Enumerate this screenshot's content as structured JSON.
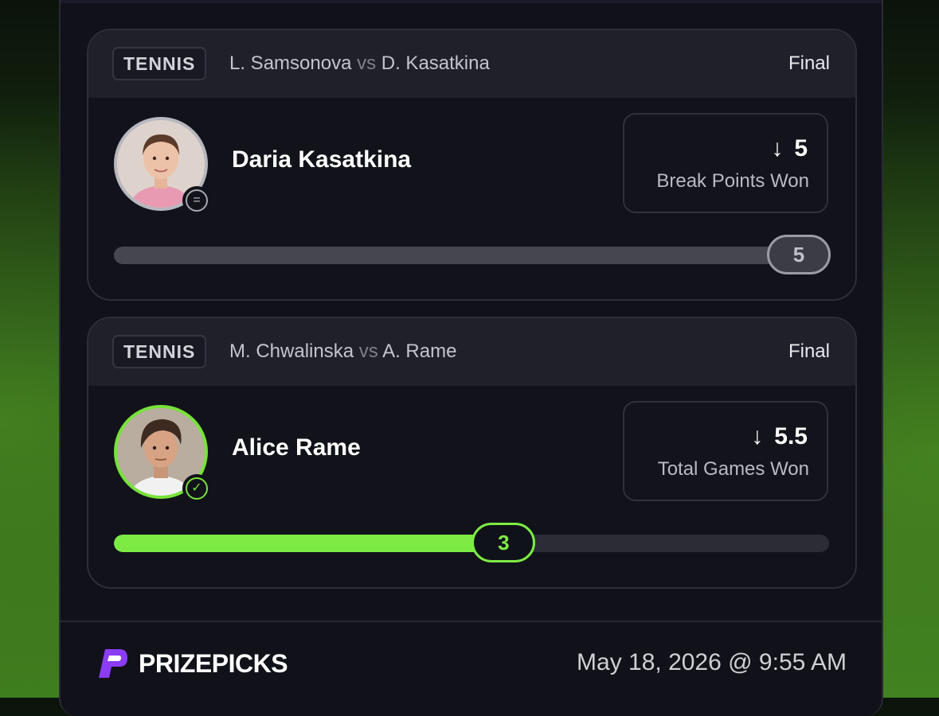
{
  "cards": [
    {
      "sport": "TENNIS",
      "player1": "L. Samsonova",
      "vs": "vs",
      "player2": "D. Kasatkina",
      "status": "Final",
      "player_name": "Daria Kasatkina",
      "direction_icon": "arrow-down-icon",
      "line": "5",
      "stat_type": "Break Points Won",
      "result_badge_icon": "equals-icon",
      "progress_value": "5",
      "progress_fraction": 1.0,
      "progress_color": "#45464f"
    },
    {
      "sport": "TENNIS",
      "player1": "M. Chwalinska",
      "vs": "vs",
      "player2": "A. Rame",
      "status": "Final",
      "player_name": "Alice Rame",
      "direction_icon": "arrow-down-icon",
      "line": "5.5",
      "stat_type": "Total Games Won",
      "result_badge_icon": "check-icon",
      "progress_value": "3",
      "progress_fraction": 0.545,
      "progress_color": "#7deb44"
    }
  ],
  "footer": {
    "brand": "PRIZEPICKS",
    "timestamp": "May 18, 2026 @ 9:55 AM"
  },
  "colors": {
    "accent_green": "#7deb44",
    "panel_bg": "#101119"
  }
}
